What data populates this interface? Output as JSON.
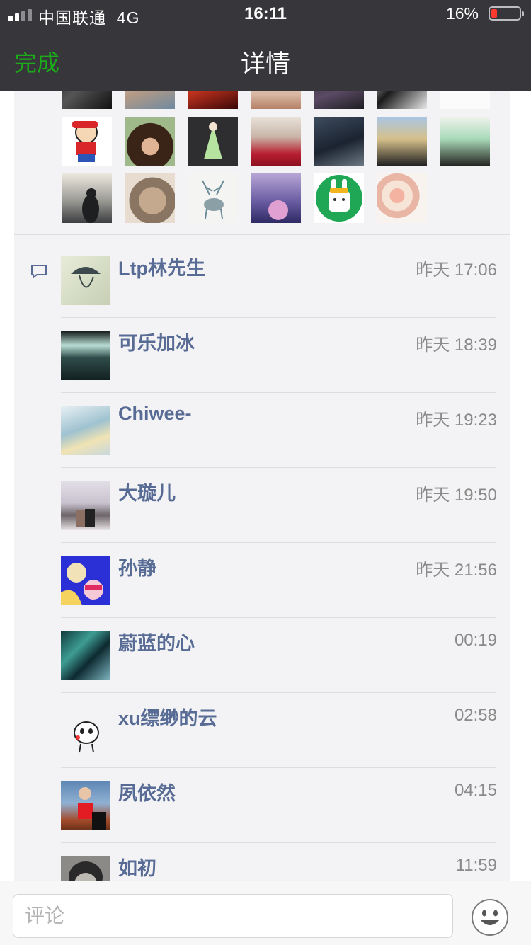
{
  "status_bar": {
    "carrier": "中国联通",
    "network": "4G",
    "time": "16:11",
    "battery": "16%"
  },
  "nav": {
    "done_label": "完成",
    "title": "详情"
  },
  "colors": {
    "accent": "#1aad19",
    "name_link": "#576b95",
    "header_bg": "#37363b"
  },
  "likes": {
    "avatars_row1": [
      "avatar-dark-hair",
      "avatar-man",
      "avatar-red-cloth",
      "avatar-reeds",
      "avatar-dark-figure",
      "avatar-girl-bw",
      "avatar-white-sketch"
    ],
    "avatars_row2": [
      "avatar-crayon-shin",
      "avatar-curly-child",
      "avatar-anime-green-dress",
      "avatar-woman-red",
      "avatar-dark-warrior",
      "avatar-blonde-girl",
      "avatar-anime-green-hair"
    ],
    "avatars_row3": [
      "avatar-silhouette-lake",
      "avatar-cat",
      "avatar-deer-ink",
      "avatar-purple-girl",
      "avatar-rabbit-badge",
      "avatar-flowers"
    ]
  },
  "comments": [
    {
      "name": "Ltp林先生",
      "time": "昨天 17:06",
      "avatar": "avatar-sketch-hat"
    },
    {
      "name": "可乐加冰",
      "time": "昨天 18:39",
      "avatar": "avatar-waterfall"
    },
    {
      "name": "Chiwee-",
      "time": "昨天 19:23",
      "avatar": "avatar-keyboard"
    },
    {
      "name": "大璇儿",
      "time": "昨天 19:50",
      "avatar": "avatar-couple-snow"
    },
    {
      "name": "孙静",
      "time": "昨天 21:56",
      "avatar": "avatar-pop-art"
    },
    {
      "name": "蔚蓝的心",
      "time": "00:19",
      "avatar": "avatar-teal-abstract"
    },
    {
      "name": "xu缥缈的云",
      "time": "02:58",
      "avatar": "avatar-panda-cartoon"
    },
    {
      "name": "夙依然",
      "time": "04:15",
      "avatar": "avatar-girl-red-top"
    },
    {
      "name": "如初",
      "time": "11:59",
      "avatar": "avatar-sketch-face"
    }
  ],
  "comment_bar": {
    "placeholder": "评论",
    "emoji_icon": "smiley-icon"
  }
}
